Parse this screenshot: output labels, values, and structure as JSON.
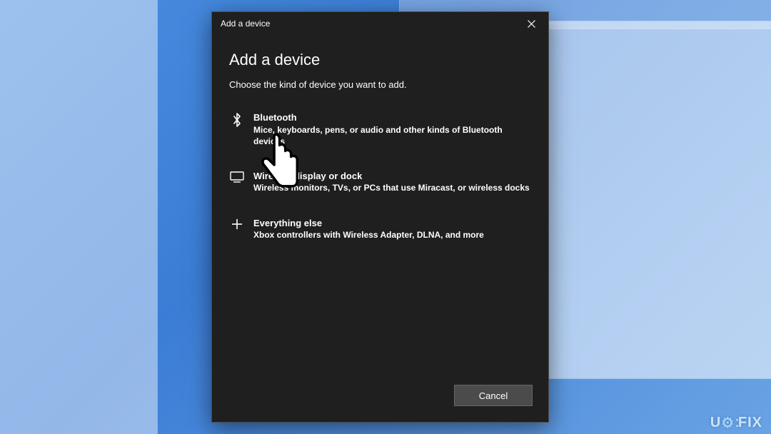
{
  "window": {
    "titlebar": "Add a device"
  },
  "dialog": {
    "heading": "Add a device",
    "subheading": "Choose the kind of device you want to add.",
    "options": [
      {
        "icon": "bluetooth-icon",
        "title": "Bluetooth",
        "description": "Mice, keyboards, pens, or audio and other kinds of Bluetooth devices"
      },
      {
        "icon": "display-icon",
        "title": "Wireless display or dock",
        "description": "Wireless monitors, TVs, or PCs that use Miracast, or wireless docks"
      },
      {
        "icon": "plus-icon",
        "title": "Everything else",
        "description": "Xbox controllers with Wireless Adapter, DLNA, and more"
      }
    ],
    "cancel_label": "Cancel"
  },
  "watermark": "U   FIX"
}
